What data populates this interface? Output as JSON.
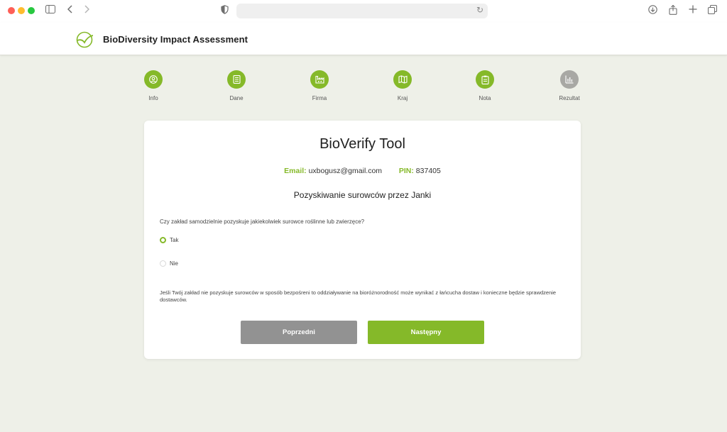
{
  "browser": {
    "address_text": ""
  },
  "header": {
    "brand": "BioDiversity Impact Assessment"
  },
  "steps": [
    {
      "label": "Info",
      "icon": "user-icon",
      "active": true
    },
    {
      "label": "Dane",
      "icon": "document-icon",
      "active": true
    },
    {
      "label": "Firma",
      "icon": "factory-icon",
      "active": true
    },
    {
      "label": "Kraj",
      "icon": "map-icon",
      "active": true
    },
    {
      "label": "Nota",
      "icon": "clipboard-icon",
      "active": true
    },
    {
      "label": "Rezultat",
      "icon": "bar-chart-icon",
      "active": false
    }
  ],
  "card": {
    "title": "BioVerify Tool",
    "email_label": "Email:",
    "email_value": "uxbogusz@gmail.com",
    "pin_label": "PIN:",
    "pin_value": "837405",
    "section_title": "Pozyskiwanie surowców przez Janki",
    "question": "Czy zakład samodzielnie pozyskuje jakiekolwiek surowce roślinne lub zwierzęce?",
    "options": [
      {
        "label": "Tak",
        "selected": true
      },
      {
        "label": "Nie",
        "selected": false
      }
    ],
    "note": "Jeśli Twój zakład nie pozyskuje surowców w sposób bezpośreni to oddziaływanie na bioróżnorodność może wynikać z łańcucha dostaw i konieczne będzie sprawdzenie dostawców.",
    "prev_label": "Poprzedni",
    "next_label": "Następny"
  },
  "colors": {
    "accent": "#85b929",
    "inactive": "#a8a8a4",
    "background": "#eef0e8",
    "prev_button": "#929292"
  }
}
